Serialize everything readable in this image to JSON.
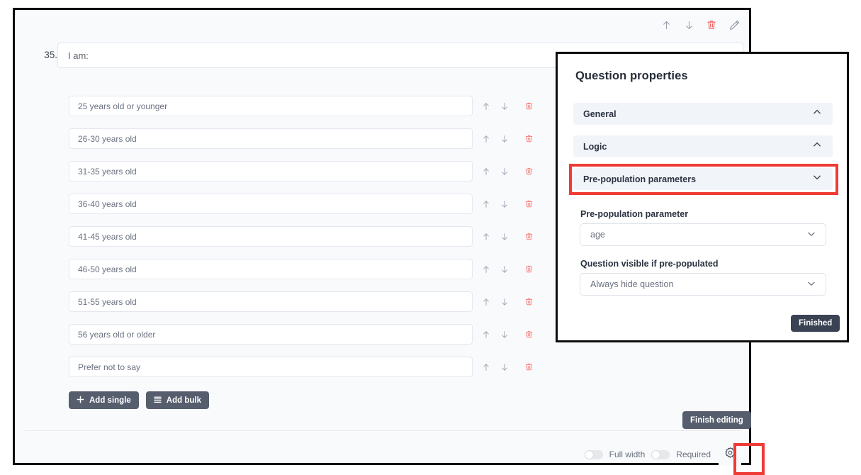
{
  "editor": {
    "question_number": "35.",
    "question_title": "I am:",
    "toolbar": {
      "move_up": "move-up",
      "move_down": "move-down",
      "delete": "delete",
      "edit": "edit"
    },
    "options": [
      "25 years old or younger",
      "26-30 years old",
      "31-35 years old",
      "36-40 years old",
      "41-45 years old",
      "46-50 years old",
      "51-55 years old",
      "56 years old or older",
      "Prefer not to say"
    ],
    "buttons": {
      "add_single": "Add single",
      "add_bulk": "Add bulk",
      "finish_editing": "Finish editing"
    },
    "footer": {
      "full_width_label": "Full width",
      "full_width_state": "off",
      "required_label": "Required",
      "required_state": "off"
    }
  },
  "properties_panel": {
    "title": "Question properties",
    "sections": [
      {
        "label": "General",
        "chevron": "chevron-up-icon"
      },
      {
        "label": "Logic",
        "chevron": "chevron-up-icon"
      },
      {
        "label": "Pre-population parameters",
        "chevron": "chevron-down-icon"
      }
    ],
    "fields": {
      "prepopulation_parameter_label": "Pre-population parameter",
      "prepopulation_parameter_value": "age",
      "question_visible_label": "Question visible if pre-populated",
      "question_visible_value": "Always hide question"
    },
    "finished_button": "Finished"
  },
  "highlights": {
    "color": "#ef3b36",
    "targets": [
      "pre-population-parameters-section",
      "settings-gear-button"
    ]
  },
  "colors": {
    "page_background": "#f8fafc",
    "window_border": "#0d0d0f",
    "accordion_background": "#f1f4f9",
    "button_dark": "#565e6d",
    "button_finished": "#3a4253",
    "trash_red": "#f87c78",
    "delete_red": "#f0625c",
    "text_primary": "#2b3240",
    "text_muted": "#6a7180"
  }
}
